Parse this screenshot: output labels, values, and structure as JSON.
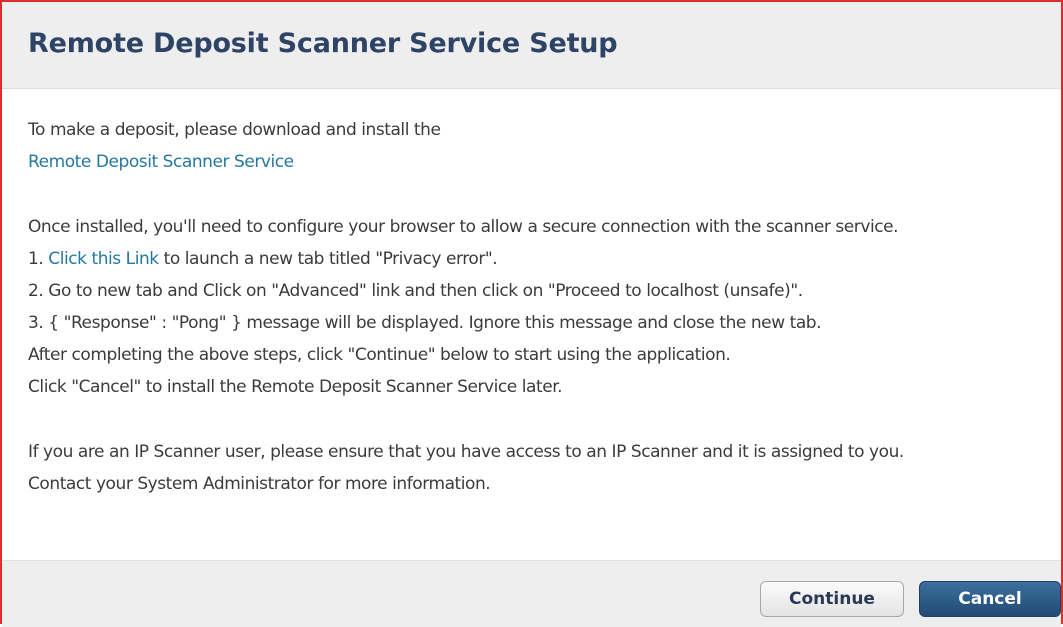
{
  "dialog": {
    "title": "Remote Deposit Scanner Service Setup"
  },
  "body": {
    "intro_text": "To make a deposit, please download and install the",
    "download_link": "Remote Deposit Scanner Service",
    "configure_text": "Once installed, you'll need to configure your browser to allow a secure connection with the scanner service.",
    "step1_prefix": "1. ",
    "step1_link": "Click this Link",
    "step1_suffix": " to launch a new tab titled \"Privacy error\".",
    "step2": "2. Go to new tab and Click on \"Advanced\" link and then click on \"Proceed to localhost (unsafe)\".",
    "step3": "3. { \"Response\" : \"Pong\" } message will be displayed. Ignore this message and close the new tab.",
    "after_steps": "After completing the above steps, click \"Continue\" below to start using the application.",
    "cancel_hint": "Click \"Cancel\" to install the Remote Deposit Scanner Service later.",
    "ip_scanner_note": "If you are an IP Scanner user, please ensure that you have access to an IP Scanner and it is assigned to you.",
    "contact_admin": "Contact your System Administrator for more information."
  },
  "footer": {
    "continue_label": "Continue",
    "cancel_label": "Cancel"
  }
}
